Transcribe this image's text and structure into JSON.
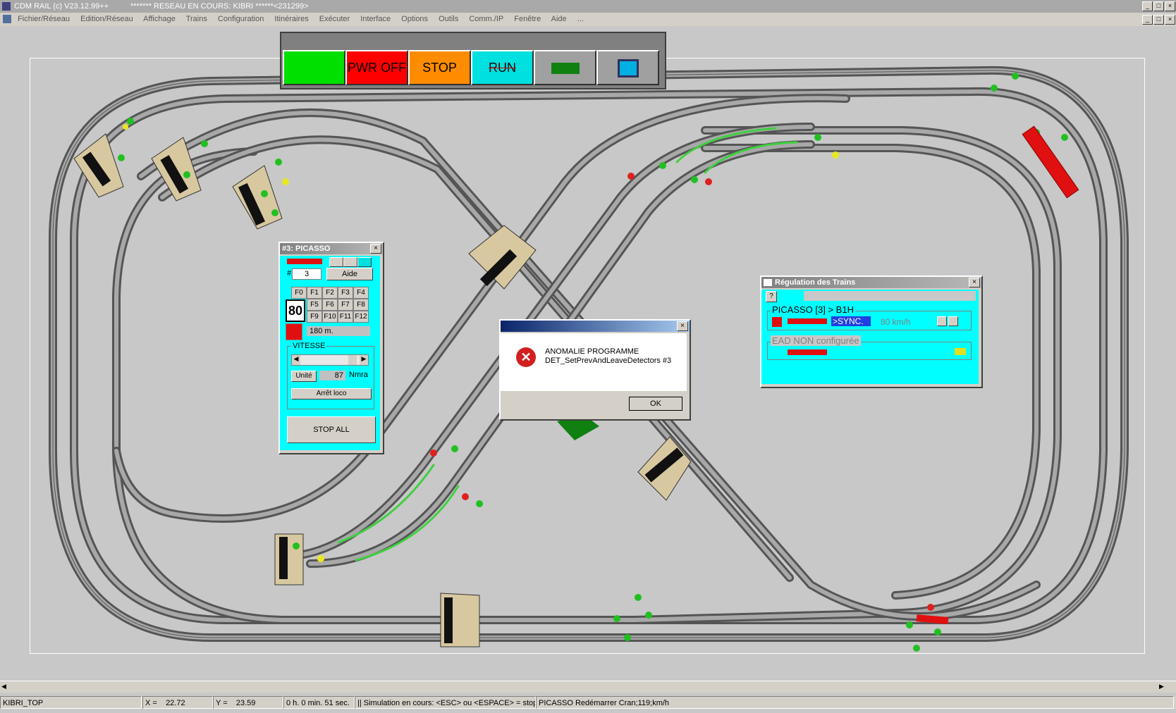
{
  "app": {
    "title": "CDM RAIL (c) V23.12.99++",
    "subtitle": "******* RESEAU EN COURS: KIBRI ******<231299>"
  },
  "menu": [
    "Fichier/Réseau",
    "Edition/Réseau",
    "Affichage",
    "Trains",
    "Configuration",
    "Itinéraires",
    "Exécuter",
    "Interface",
    "Options",
    "Outils",
    "Comm./IP",
    "Fenêtre",
    "Aide",
    "..."
  ],
  "toolbar": {
    "pwr_off": "PWR OFF",
    "stop": "STOP",
    "run": "RUN",
    "colors": {
      "green": "#00e000",
      "red": "#ff0000",
      "orange": "#ff8c00",
      "cyan": "#00e0e0",
      "gray": "#a0a0a0"
    }
  },
  "loco_panel": {
    "title": "#3: PICASSO",
    "number_label": "#",
    "number": "3",
    "aide": "Aide",
    "fkeys": [
      "F0",
      "F1",
      "F2",
      "F3",
      "F4",
      "F5",
      "F6",
      "F7",
      "F8",
      "F9",
      "F10",
      "F11",
      "F12"
    ],
    "speed_sign": "80",
    "distance": "180 m.",
    "vitesse_label": "VITESSE",
    "unite": "Unité",
    "speed_value": "87",
    "nmra": "Nmra",
    "arret": "Arrêt loco",
    "stop_all": "STOP ALL"
  },
  "error_dialog": {
    "line1": "ANOMALIE PROGRAMME",
    "line2": "DET_SetPrevAndLeaveDetectors #3",
    "ok": "OK"
  },
  "regulation": {
    "title": "Régulation des Trains",
    "help": "?",
    "train1": "PICASSO [3] > B1H",
    "sync": ">SYNC.",
    "speed": "80 km/h",
    "train2": "EAD NON configurée"
  },
  "status": {
    "network": "KIBRI_TOP",
    "x_label": "X =",
    "x_value": "22.72",
    "y_label": "Y =",
    "y_value": "23.59",
    "time": "0 h. 0 min. 51 sec.",
    "sim": "|| Simulation en cours: <ESC> ou <ESPACE> = stop",
    "msg": "PICASSO Redémarrer Cran;119;km/h"
  }
}
